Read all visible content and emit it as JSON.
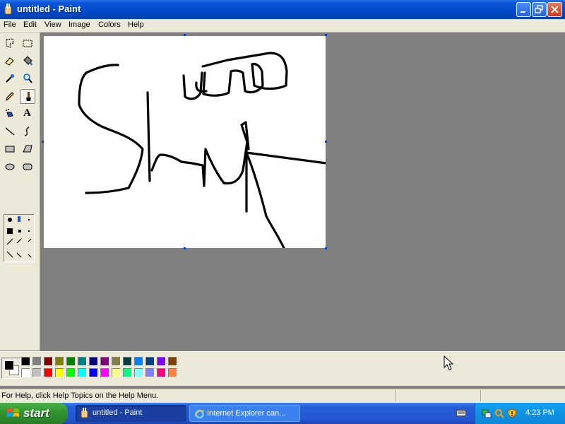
{
  "window": {
    "title": "untitled - Paint"
  },
  "menu": [
    {
      "label": "File"
    },
    {
      "label": "Edit"
    },
    {
      "label": "View"
    },
    {
      "label": "Image"
    },
    {
      "label": "Colors"
    },
    {
      "label": "Help"
    }
  ],
  "tools": [
    "free-form-select",
    "select",
    "eraser",
    "fill-with-color",
    "pick-color",
    "magnifier",
    "pencil",
    "brush",
    "airbrush",
    "text",
    "line",
    "curve",
    "rectangle",
    "polygon",
    "ellipse",
    "rounded-rectangle"
  ],
  "selected_tool": "brush",
  "text_tool_glyph": "A",
  "colors": {
    "foreground": "#000000",
    "background": "#ffffff",
    "palette_row1": [
      "#000000",
      "#808080",
      "#800000",
      "#808000",
      "#008000",
      "#008080",
      "#000080",
      "#800080",
      "#808040",
      "#004040",
      "#0080ff",
      "#004080",
      "#8000ff",
      "#804000"
    ],
    "palette_row2": [
      "#ffffff",
      "#c0c0c0",
      "#ff0000",
      "#ffff00",
      "#00ff00",
      "#00ffff",
      "#0000ff",
      "#ff00ff",
      "#ffff80",
      "#00ff80",
      "#80ffff",
      "#8080ff",
      "#ff0080",
      "#ff8040"
    ]
  },
  "status": {
    "text": "For Help, click Help Topics on the Help Menu."
  },
  "taskbar": {
    "start_label": "start",
    "tasks": [
      {
        "label": "untitled - Paint"
      },
      {
        "label": "Internet Explorer can..."
      }
    ],
    "clock": "4:23 PM"
  }
}
